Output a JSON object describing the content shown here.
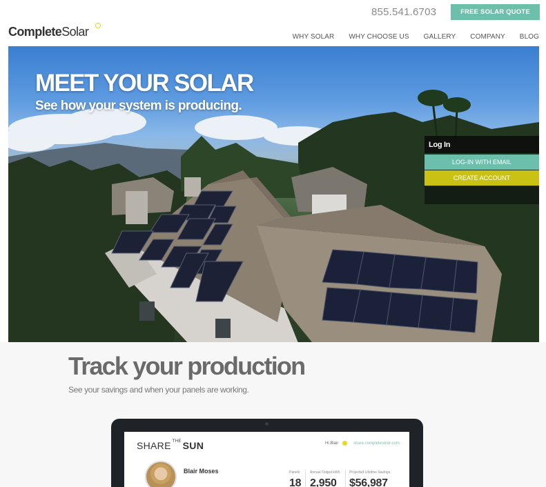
{
  "header": {
    "phone": "855.541.6703",
    "quote_button": "FREE SOLAR QUOTE",
    "logo_bold": "Complete",
    "logo_light": "Solar",
    "nav": [
      "WHY SOLAR",
      "WHY CHOOSE US",
      "GALLERY",
      "COMPANY",
      "BLOG"
    ]
  },
  "hero": {
    "title": "MEET YOUR SOLAR",
    "subtitle": "See how your system is producing.",
    "login": {
      "title": "Log In",
      "email_button": "LOG-IN WITH EMAIL",
      "create_button": "CREATE ACCOUNT"
    }
  },
  "track": {
    "title_bold": "Track",
    "title_rest": " your production",
    "subtitle": "See your savings and when your panels are working."
  },
  "app_preview": {
    "brand_share": "SHARE",
    "brand_the": "THE",
    "brand_sun": "SUN",
    "greeting": "Hi Blair",
    "url": "share.completesolar.com",
    "user_name": "Blair Moses",
    "stats": [
      {
        "label": "Panels",
        "value": "18"
      },
      {
        "label": "Annual Output kWh",
        "value": "2,950"
      },
      {
        "label": "Projected Lifetime Savings",
        "value": "$56,987"
      }
    ]
  },
  "colors": {
    "accent_teal": "#6cbfaa",
    "accent_yellow": "#c9c214",
    "sun_yellow": "#e8d820"
  }
}
